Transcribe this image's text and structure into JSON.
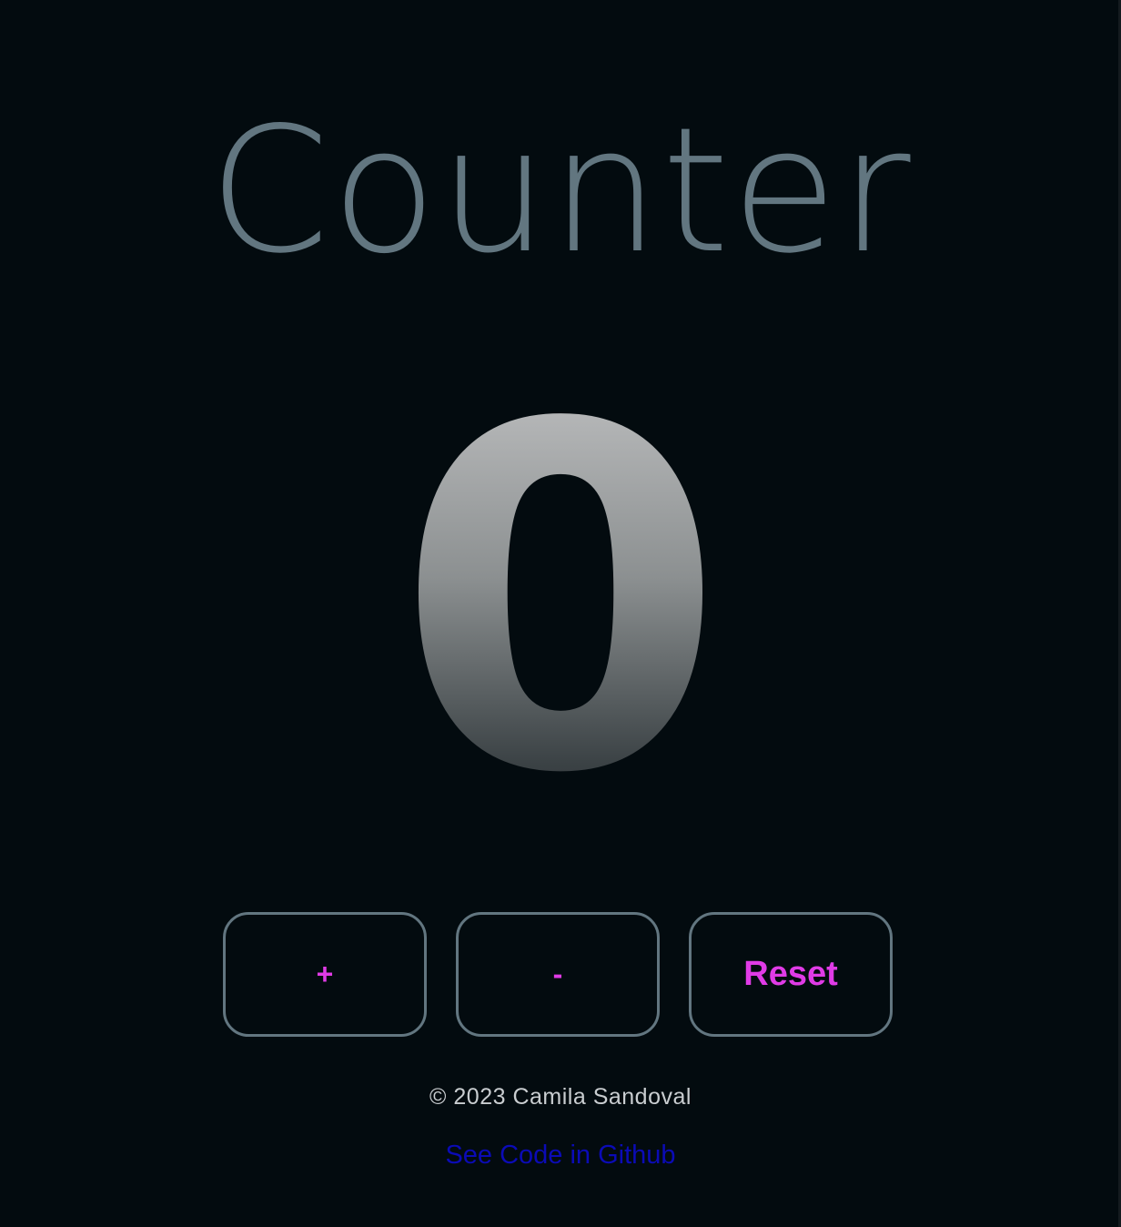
{
  "app": {
    "title": "Counter",
    "count": "0"
  },
  "controls": {
    "increment_label": "+",
    "decrement_label": "-",
    "reset_label": "Reset"
  },
  "footer": {
    "copyright": "© 2023 Camila Sandoval",
    "link_text": "See Code in Github"
  },
  "colors": {
    "background": "#030b0f",
    "title": "#627680",
    "button_border": "#627680",
    "button_text": "#e03be6",
    "link": "#0b0bb6",
    "footer_text": "#c9cdd0"
  }
}
